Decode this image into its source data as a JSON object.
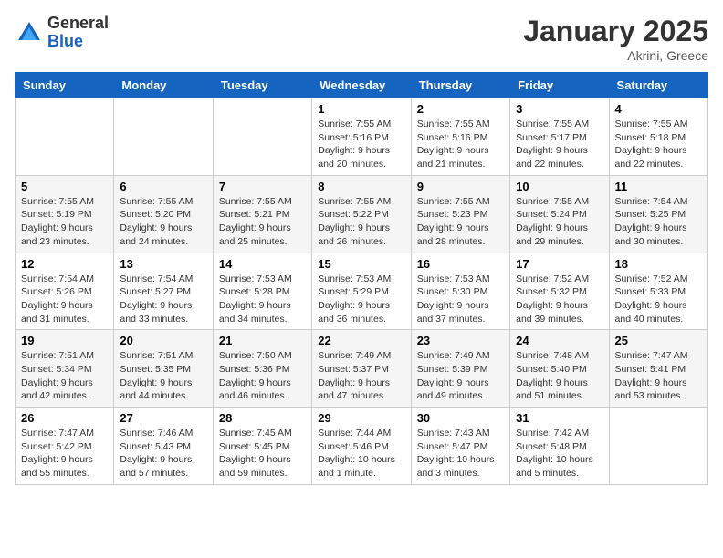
{
  "header": {
    "logo_general": "General",
    "logo_blue": "Blue",
    "month_title": "January 2025",
    "location": "Akrini, Greece"
  },
  "weekdays": [
    "Sunday",
    "Monday",
    "Tuesday",
    "Wednesday",
    "Thursday",
    "Friday",
    "Saturday"
  ],
  "weeks": [
    [
      {
        "day": "",
        "sunrise": "",
        "sunset": "",
        "daylight": ""
      },
      {
        "day": "",
        "sunrise": "",
        "sunset": "",
        "daylight": ""
      },
      {
        "day": "",
        "sunrise": "",
        "sunset": "",
        "daylight": ""
      },
      {
        "day": "1",
        "sunrise": "Sunrise: 7:55 AM",
        "sunset": "Sunset: 5:16 PM",
        "daylight": "Daylight: 9 hours and 20 minutes."
      },
      {
        "day": "2",
        "sunrise": "Sunrise: 7:55 AM",
        "sunset": "Sunset: 5:16 PM",
        "daylight": "Daylight: 9 hours and 21 minutes."
      },
      {
        "day": "3",
        "sunrise": "Sunrise: 7:55 AM",
        "sunset": "Sunset: 5:17 PM",
        "daylight": "Daylight: 9 hours and 22 minutes."
      },
      {
        "day": "4",
        "sunrise": "Sunrise: 7:55 AM",
        "sunset": "Sunset: 5:18 PM",
        "daylight": "Daylight: 9 hours and 22 minutes."
      }
    ],
    [
      {
        "day": "5",
        "sunrise": "Sunrise: 7:55 AM",
        "sunset": "Sunset: 5:19 PM",
        "daylight": "Daylight: 9 hours and 23 minutes."
      },
      {
        "day": "6",
        "sunrise": "Sunrise: 7:55 AM",
        "sunset": "Sunset: 5:20 PM",
        "daylight": "Daylight: 9 hours and 24 minutes."
      },
      {
        "day": "7",
        "sunrise": "Sunrise: 7:55 AM",
        "sunset": "Sunset: 5:21 PM",
        "daylight": "Daylight: 9 hours and 25 minutes."
      },
      {
        "day": "8",
        "sunrise": "Sunrise: 7:55 AM",
        "sunset": "Sunset: 5:22 PM",
        "daylight": "Daylight: 9 hours and 26 minutes."
      },
      {
        "day": "9",
        "sunrise": "Sunrise: 7:55 AM",
        "sunset": "Sunset: 5:23 PM",
        "daylight": "Daylight: 9 hours and 28 minutes."
      },
      {
        "day": "10",
        "sunrise": "Sunrise: 7:55 AM",
        "sunset": "Sunset: 5:24 PM",
        "daylight": "Daylight: 9 hours and 29 minutes."
      },
      {
        "day": "11",
        "sunrise": "Sunrise: 7:54 AM",
        "sunset": "Sunset: 5:25 PM",
        "daylight": "Daylight: 9 hours and 30 minutes."
      }
    ],
    [
      {
        "day": "12",
        "sunrise": "Sunrise: 7:54 AM",
        "sunset": "Sunset: 5:26 PM",
        "daylight": "Daylight: 9 hours and 31 minutes."
      },
      {
        "day": "13",
        "sunrise": "Sunrise: 7:54 AM",
        "sunset": "Sunset: 5:27 PM",
        "daylight": "Daylight: 9 hours and 33 minutes."
      },
      {
        "day": "14",
        "sunrise": "Sunrise: 7:53 AM",
        "sunset": "Sunset: 5:28 PM",
        "daylight": "Daylight: 9 hours and 34 minutes."
      },
      {
        "day": "15",
        "sunrise": "Sunrise: 7:53 AM",
        "sunset": "Sunset: 5:29 PM",
        "daylight": "Daylight: 9 hours and 36 minutes."
      },
      {
        "day": "16",
        "sunrise": "Sunrise: 7:53 AM",
        "sunset": "Sunset: 5:30 PM",
        "daylight": "Daylight: 9 hours and 37 minutes."
      },
      {
        "day": "17",
        "sunrise": "Sunrise: 7:52 AM",
        "sunset": "Sunset: 5:32 PM",
        "daylight": "Daylight: 9 hours and 39 minutes."
      },
      {
        "day": "18",
        "sunrise": "Sunrise: 7:52 AM",
        "sunset": "Sunset: 5:33 PM",
        "daylight": "Daylight: 9 hours and 40 minutes."
      }
    ],
    [
      {
        "day": "19",
        "sunrise": "Sunrise: 7:51 AM",
        "sunset": "Sunset: 5:34 PM",
        "daylight": "Daylight: 9 hours and 42 minutes."
      },
      {
        "day": "20",
        "sunrise": "Sunrise: 7:51 AM",
        "sunset": "Sunset: 5:35 PM",
        "daylight": "Daylight: 9 hours and 44 minutes."
      },
      {
        "day": "21",
        "sunrise": "Sunrise: 7:50 AM",
        "sunset": "Sunset: 5:36 PM",
        "daylight": "Daylight: 9 hours and 46 minutes."
      },
      {
        "day": "22",
        "sunrise": "Sunrise: 7:49 AM",
        "sunset": "Sunset: 5:37 PM",
        "daylight": "Daylight: 9 hours and 47 minutes."
      },
      {
        "day": "23",
        "sunrise": "Sunrise: 7:49 AM",
        "sunset": "Sunset: 5:39 PM",
        "daylight": "Daylight: 9 hours and 49 minutes."
      },
      {
        "day": "24",
        "sunrise": "Sunrise: 7:48 AM",
        "sunset": "Sunset: 5:40 PM",
        "daylight": "Daylight: 9 hours and 51 minutes."
      },
      {
        "day": "25",
        "sunrise": "Sunrise: 7:47 AM",
        "sunset": "Sunset: 5:41 PM",
        "daylight": "Daylight: 9 hours and 53 minutes."
      }
    ],
    [
      {
        "day": "26",
        "sunrise": "Sunrise: 7:47 AM",
        "sunset": "Sunset: 5:42 PM",
        "daylight": "Daylight: 9 hours and 55 minutes."
      },
      {
        "day": "27",
        "sunrise": "Sunrise: 7:46 AM",
        "sunset": "Sunset: 5:43 PM",
        "daylight": "Daylight: 9 hours and 57 minutes."
      },
      {
        "day": "28",
        "sunrise": "Sunrise: 7:45 AM",
        "sunset": "Sunset: 5:45 PM",
        "daylight": "Daylight: 9 hours and 59 minutes."
      },
      {
        "day": "29",
        "sunrise": "Sunrise: 7:44 AM",
        "sunset": "Sunset: 5:46 PM",
        "daylight": "Daylight: 10 hours and 1 minute."
      },
      {
        "day": "30",
        "sunrise": "Sunrise: 7:43 AM",
        "sunset": "Sunset: 5:47 PM",
        "daylight": "Daylight: 10 hours and 3 minutes."
      },
      {
        "day": "31",
        "sunrise": "Sunrise: 7:42 AM",
        "sunset": "Sunset: 5:48 PM",
        "daylight": "Daylight: 10 hours and 5 minutes."
      },
      {
        "day": "",
        "sunrise": "",
        "sunset": "",
        "daylight": ""
      }
    ]
  ]
}
